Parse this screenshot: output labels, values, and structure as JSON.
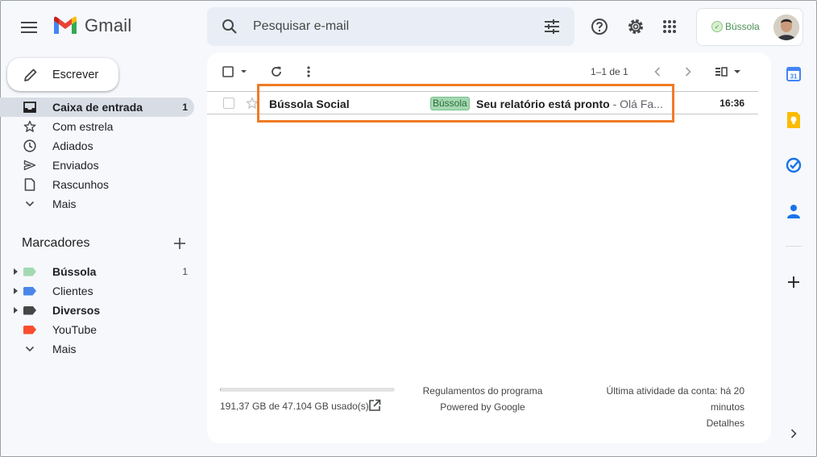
{
  "app": {
    "name": "Gmail"
  },
  "search": {
    "placeholder": "Pesquisar e-mail"
  },
  "account": {
    "brand": "Bússola"
  },
  "compose": {
    "label": "Escrever"
  },
  "nav": [
    {
      "id": "inbox",
      "label": "Caixa de entrada",
      "count": "1",
      "icon": "inbox-icon"
    },
    {
      "id": "starred",
      "label": "Com estrela",
      "icon": "star-icon"
    },
    {
      "id": "snoozed",
      "label": "Adiados",
      "icon": "clock-icon"
    },
    {
      "id": "sent",
      "label": "Enviados",
      "icon": "send-icon"
    },
    {
      "id": "drafts",
      "label": "Rascunhos",
      "icon": "draft-icon"
    },
    {
      "id": "more",
      "label": "Mais",
      "icon": "chevron-down-icon"
    }
  ],
  "labels_section": {
    "title": "Marcadores"
  },
  "labels": [
    {
      "label": "Bússola",
      "count": "1",
      "color": "#a3d9b1",
      "bold": true
    },
    {
      "label": "Clientes",
      "color": "#4a86e8",
      "bold": false
    },
    {
      "label": "Diversos",
      "color": "#444746",
      "bold": true
    },
    {
      "label": "YouTube",
      "color": "#fb4c2f",
      "bold": false
    },
    {
      "label": "Mais"
    }
  ],
  "toolbar": {
    "pagination": "1–1 de 1"
  },
  "emails": [
    {
      "sender": "Bússola Social",
      "label_chip": "Bússola",
      "subject": "Seu relatório está pronto",
      "snippet": " - Olá Fa...",
      "time": "16:36"
    }
  ],
  "footer": {
    "storage": "191,37 GB de 47.104 GB usado(s)",
    "storage_fraction": 0.004,
    "program_policies": "Regulamentos do programa",
    "powered_by": "Powered by Google",
    "last_activity_line1": "Última atividade da conta: há 20",
    "last_activity_line2": "minutos",
    "details": "Detalhes"
  },
  "colors": {
    "highlight": "#f07b24",
    "accent": "#0b57d0"
  }
}
